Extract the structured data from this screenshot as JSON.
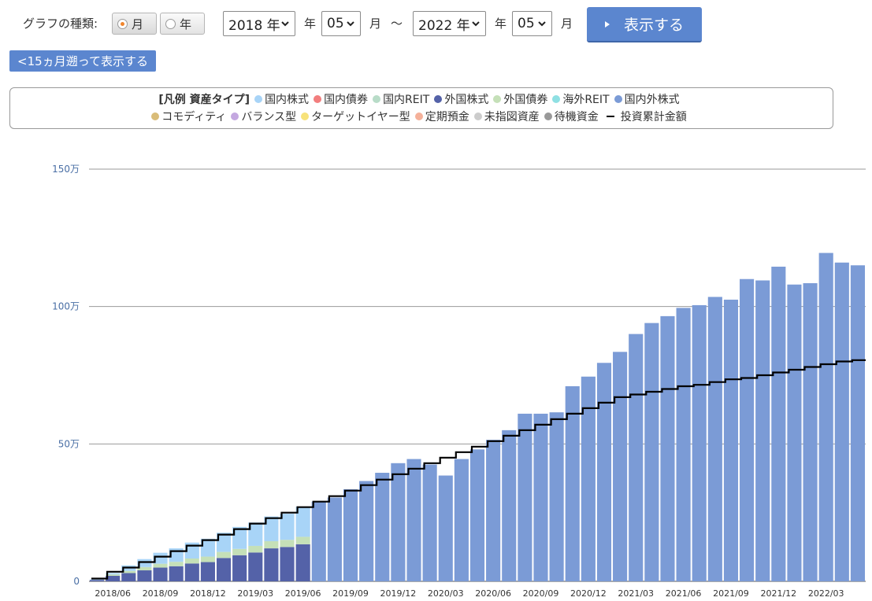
{
  "controls": {
    "graph_type_label": "グラフの種類:",
    "radio_month": "月",
    "radio_year": "年",
    "selected": "month",
    "start_year": "2018 年",
    "start_year_suffix": "年",
    "start_month": "05",
    "start_month_suffix": "月",
    "tilde": "～",
    "end_year": "2022 年",
    "end_year_suffix": "年",
    "end_month": "05",
    "end_month_suffix": "月",
    "show_button": "表示する",
    "back_button": "<15ヵ月遡って表示する"
  },
  "legend": {
    "title": "[凡例 資産タイプ]",
    "items": [
      {
        "label": "国内株式",
        "color": "#a8d4f7",
        "shape": "dot"
      },
      {
        "label": "国内債券",
        "color": "#f27e7e",
        "shape": "dot"
      },
      {
        "label": "国内REIT",
        "color": "#b8dcc8",
        "shape": "dot"
      },
      {
        "label": "外国株式",
        "color": "#5462a8",
        "shape": "dot"
      },
      {
        "label": "外国債券",
        "color": "#c5e0b8",
        "shape": "dot"
      },
      {
        "label": "海外REIT",
        "color": "#8fe0e3",
        "shape": "dot"
      },
      {
        "label": "国内外株式",
        "color": "#7b9bd6",
        "shape": "dot"
      },
      {
        "label": "コモディティ",
        "color": "#d9bc78",
        "shape": "dot"
      },
      {
        "label": "バランス型",
        "color": "#c4a8e0",
        "shape": "dot"
      },
      {
        "label": "ターゲットイヤー型",
        "color": "#f7e27a",
        "shape": "dot"
      },
      {
        "label": "定期預金",
        "color": "#f5b19a",
        "shape": "dot"
      },
      {
        "label": "未指図資産",
        "color": "#cccccc",
        "shape": "dot"
      },
      {
        "label": "待機資金",
        "color": "#999999",
        "shape": "dot"
      },
      {
        "label": "投資累計金額",
        "color": "#000000",
        "shape": "line"
      }
    ]
  },
  "chart_data": {
    "type": "bar",
    "stacked": true,
    "y_unit": "円",
    "ylim": [
      0,
      1500000
    ],
    "yticks": [
      0,
      500000,
      1000000,
      1500000
    ],
    "ytick_labels": [
      "0",
      "50万",
      "100万",
      "150万"
    ],
    "grid": true,
    "categories": [
      "2018/05",
      "2018/06",
      "2018/07",
      "2018/08",
      "2018/09",
      "2018/10",
      "2018/11",
      "2018/12",
      "2019/01",
      "2019/02",
      "2019/03",
      "2019/04",
      "2019/05",
      "2019/06",
      "2019/07",
      "2019/08",
      "2019/09",
      "2019/10",
      "2019/11",
      "2019/12",
      "2020/01",
      "2020/02",
      "2020/03",
      "2020/04",
      "2020/05",
      "2020/06",
      "2020/07",
      "2020/08",
      "2020/09",
      "2020/10",
      "2020/11",
      "2020/12",
      "2021/01",
      "2021/02",
      "2021/03",
      "2021/04",
      "2021/05",
      "2021/06",
      "2021/07",
      "2021/08",
      "2021/09",
      "2021/10",
      "2021/11",
      "2021/12",
      "2022/01",
      "2022/02",
      "2022/03",
      "2022/04",
      "2022/05"
    ],
    "xtick_labels": [
      "2018/06",
      "2018/09",
      "2018/12",
      "2019/03",
      "2019/06",
      "2019/09",
      "2019/12",
      "2020/03",
      "2020/06",
      "2020/09",
      "2020/12",
      "2021/03",
      "2021/06",
      "2021/09",
      "2021/12",
      "2022/03"
    ],
    "series": [
      {
        "name": "外国株式",
        "color": "#5462a8",
        "values": [
          5000,
          20000,
          30000,
          40000,
          50000,
          55000,
          65000,
          70000,
          85000,
          95000,
          105000,
          120000,
          125000,
          135000,
          0,
          0,
          0,
          0,
          0,
          0,
          0,
          0,
          0,
          0,
          0,
          0,
          0,
          0,
          0,
          0,
          0,
          0,
          0,
          0,
          0,
          0,
          0,
          0,
          0,
          0,
          0,
          0,
          0,
          0,
          0,
          0,
          0,
          0,
          0
        ]
      },
      {
        "name": "外国債券",
        "color": "#c5e0b8",
        "values": [
          0,
          5000,
          8000,
          12000,
          14000,
          16000,
          18000,
          20000,
          22000,
          23000,
          24000,
          26000,
          26000,
          27000,
          0,
          0,
          0,
          0,
          0,
          0,
          0,
          0,
          0,
          0,
          0,
          0,
          0,
          0,
          0,
          0,
          0,
          0,
          0,
          0,
          0,
          0,
          0,
          0,
          0,
          0,
          0,
          0,
          0,
          0,
          0,
          0,
          0,
          0,
          0
        ]
      },
      {
        "name": "国内株式",
        "color": "#a8d4f7",
        "values": [
          2000,
          5000,
          20000,
          29000,
          40000,
          49000,
          58000,
          65000,
          70000,
          80000,
          85000,
          90000,
          95000,
          110000,
          0,
          0,
          0,
          0,
          0,
          0,
          0,
          0,
          0,
          0,
          0,
          0,
          0,
          0,
          0,
          0,
          0,
          0,
          0,
          0,
          0,
          0,
          0,
          0,
          0,
          0,
          0,
          0,
          0,
          0,
          0,
          0,
          0,
          0,
          0
        ]
      },
      {
        "name": "国内外株式",
        "color": "#7b9bd6",
        "values": [
          0,
          0,
          0,
          0,
          0,
          0,
          0,
          0,
          0,
          0,
          0,
          0,
          0,
          0,
          290000,
          305000,
          335000,
          365000,
          395000,
          430000,
          445000,
          425000,
          385000,
          445000,
          480000,
          515000,
          550000,
          610000,
          610000,
          615000,
          710000,
          745000,
          795000,
          835000,
          900000,
          940000,
          965000,
          995000,
          1005000,
          1035000,
          1025000,
          1100000,
          1095000,
          1145000,
          1080000,
          1085000,
          1195000,
          1160000,
          1150000
        ]
      }
    ],
    "cumulative": {
      "name": "投資累計金額",
      "color": "#000000",
      "values": [
        10000,
        35000,
        50000,
        70000,
        90000,
        110000,
        130000,
        150000,
        170000,
        190000,
        210000,
        230000,
        250000,
        270000,
        290000,
        310000,
        330000,
        350000,
        370000,
        390000,
        410000,
        430000,
        450000,
        470000,
        490000,
        510000,
        530000,
        550000,
        570000,
        590000,
        610000,
        630000,
        650000,
        670000,
        680000,
        690000,
        700000,
        710000,
        715000,
        725000,
        735000,
        740000,
        750000,
        760000,
        770000,
        780000,
        790000,
        800000,
        805000
      ]
    }
  }
}
